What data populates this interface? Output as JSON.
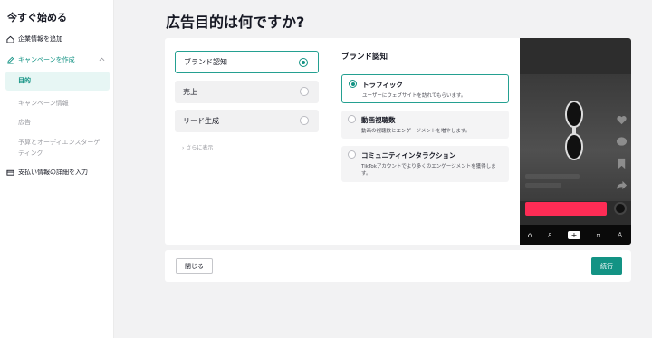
{
  "colors": {
    "accent": "#139384",
    "cta": "#fe2c55"
  },
  "sidebar": {
    "title": "今すぐ始める",
    "items": [
      {
        "label": "企業情報を追加",
        "icon": "home-icon"
      },
      {
        "label": "キャンペーンを作成",
        "icon": "edit-icon"
      },
      {
        "label": "支払い情報の詳細を入力",
        "icon": "card-icon"
      }
    ],
    "sub_items": [
      {
        "label": "目的"
      },
      {
        "label": "キャンペーン情報"
      },
      {
        "label": "広告"
      },
      {
        "label": "予算とオーディエンスターゲ"
      },
      {
        "label": "ティング"
      }
    ]
  },
  "main": {
    "title": "広告目的は何ですか?",
    "objectives": [
      {
        "label": "ブランド認知",
        "selected": true
      },
      {
        "label": "売上",
        "selected": false
      },
      {
        "label": "リード生成",
        "selected": false
      }
    ],
    "show_more": "さらに表示",
    "detail_title": "ブランド認知",
    "options": [
      {
        "title": "トラフィック",
        "desc": "ユーザーにウェブサイトを訪れてもらいます。",
        "selected": true
      },
      {
        "title": "動画視聴数",
        "desc": "動画の視聴数とエンゲージメントを増やします。",
        "selected": false
      },
      {
        "title": "コミュニティインタラクション",
        "desc": "TikTokアカウントでより多くのエンゲージメントを獲得します。",
        "selected": false
      }
    ]
  },
  "footer": {
    "close_label": "閉じる",
    "next_label": "続行"
  }
}
